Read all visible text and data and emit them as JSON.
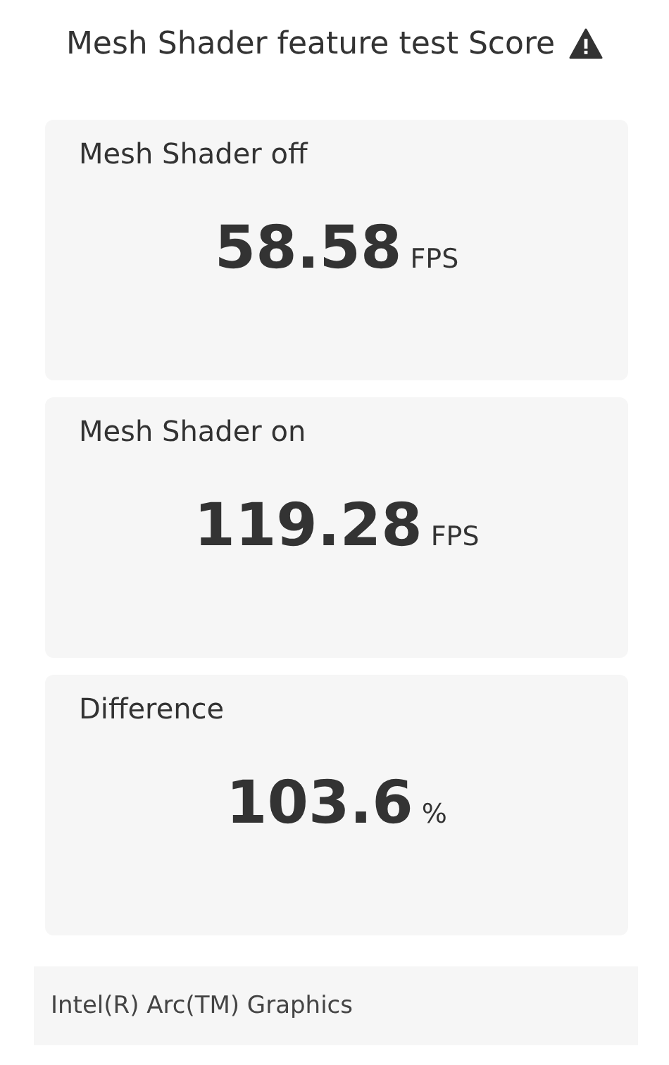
{
  "title": "Mesh Shader feature test Score",
  "results": [
    {
      "label": "Mesh Shader off",
      "value": "58.58",
      "unit": "FPS"
    },
    {
      "label": "Mesh Shader on",
      "value": "119.28",
      "unit": "FPS"
    },
    {
      "label": "Difference",
      "value": "103.6",
      "unit": "%"
    }
  ],
  "device": "Intel(R) Arc(TM) Graphics"
}
